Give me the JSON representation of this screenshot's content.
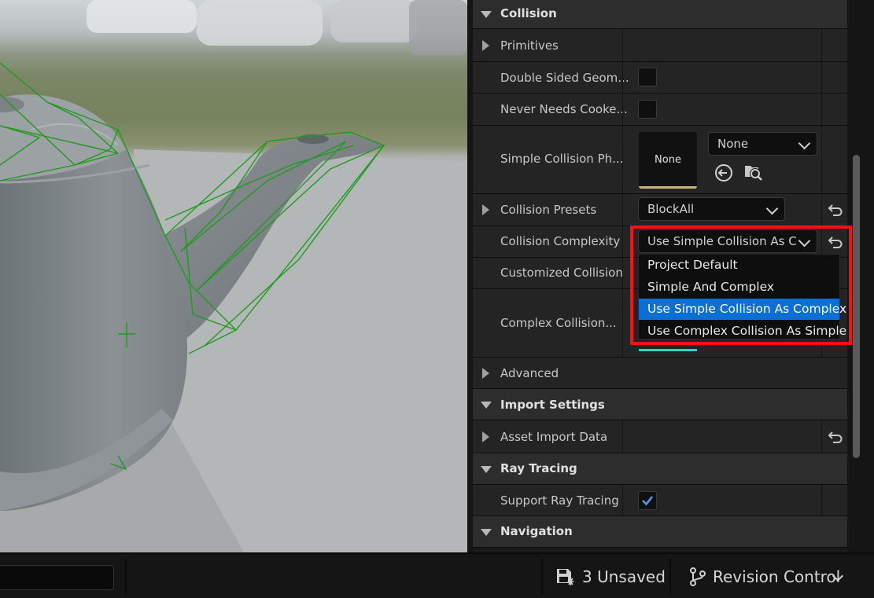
{
  "panel": {
    "sections": {
      "collision": "Collision",
      "import_settings": "Import Settings",
      "ray_tracing": "Ray Tracing",
      "navigation": "Navigation"
    },
    "rows": {
      "primitives": "Primitives",
      "double_sided": "Double Sided Geom...",
      "never_needs_cooked": "Never Needs Cooke...",
      "simple_collision_phys": "Simple Collision Ph...",
      "collision_presets": "Collision Presets",
      "collision_complexity": "Collision Complexity",
      "customized_collision": "Customized Collision",
      "complex_collision": "Complex Collision...",
      "advanced": "Advanced",
      "asset_import_data": "Asset Import Data",
      "support_ray_tracing": "Support Ray Tracing"
    },
    "values": {
      "double_sided_checked": false,
      "never_needs_cooked_checked": false,
      "physmat_thumb": "None",
      "physmat_combo": "None",
      "collision_presets": "BlockAll",
      "collision_complexity": "Use Simple Collision As C",
      "support_ray_tracing_checked": true
    }
  },
  "dropdown": {
    "options": [
      "Project Default",
      "Simple And Complex",
      "Use Simple Collision As Complex",
      "Use Complex Collision As Simple"
    ],
    "selected_index": 2
  },
  "statusbar": {
    "unsaved": "3 Unsaved",
    "revision_control": "Revision Control"
  },
  "colors": {
    "accent_selected": "#0b6fd6",
    "highlight_box": "#ff0f0f",
    "checkbox_tick": "#4a9bf0"
  }
}
